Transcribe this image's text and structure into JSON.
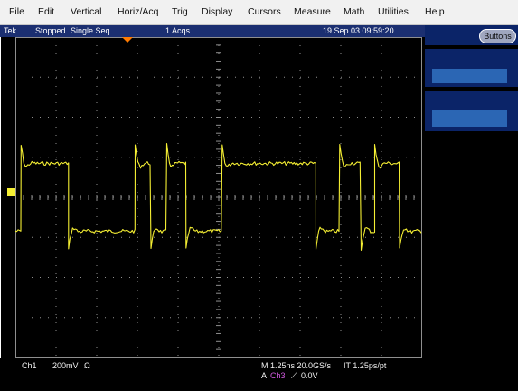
{
  "menu": [
    "File",
    "Edit",
    "Vertical",
    "Horiz/Acq",
    "Trig",
    "Display",
    "Cursors",
    "Measure",
    "Math",
    "Utilities",
    "Help"
  ],
  "status": {
    "brand": "Tek",
    "state": "Stopped",
    "mode": "Single Seq",
    "acqs": "1 Acqs",
    "datetime": "19 Sep 03 09:59:20"
  },
  "buttons_label": "Buttons",
  "readout": {
    "channel": "Ch1",
    "scale": "200mV",
    "ohm": "Ω",
    "timebase": "M 1.25ns 20.0GS/s",
    "it": "IT 1.25ps/pt",
    "trig_a": "A",
    "trig_src": "Ch3",
    "trig_slope": "⟋",
    "trig_level": "0.0V"
  },
  "colors": {
    "trace": "#f5ef33",
    "graticule": "#8f8f8f",
    "status_bg": "#1b2f71",
    "panel_bg": "#0b2468",
    "panel_inner": "#2b66b4",
    "trigger_marker": "#ff7b00",
    "trig_src": "#d25be0",
    "ch1_marker": "#f5ef33"
  },
  "waveform": {
    "high_level_div": 3.1,
    "low_level_div": -3.1,
    "segments": [
      {
        "level": "low",
        "end_div": 0.25
      },
      {
        "level": "high",
        "end_div": 2.35
      },
      {
        "level": "low",
        "end_div": 5.3
      },
      {
        "level": "high",
        "end_div": 6.0
      },
      {
        "level": "low",
        "end_div": 6.7
      },
      {
        "level": "high",
        "end_div": 7.55
      },
      {
        "level": "low",
        "end_div": 9.15
      },
      {
        "level": "high",
        "end_div": 13.3
      },
      {
        "level": "low",
        "end_div": 14.35
      },
      {
        "level": "high",
        "end_div": 15.3
      },
      {
        "level": "low",
        "end_div": 15.9
      },
      {
        "level": "high",
        "end_div": 17.0
      },
      {
        "level": "low",
        "end_div": 18.0
      }
    ]
  }
}
